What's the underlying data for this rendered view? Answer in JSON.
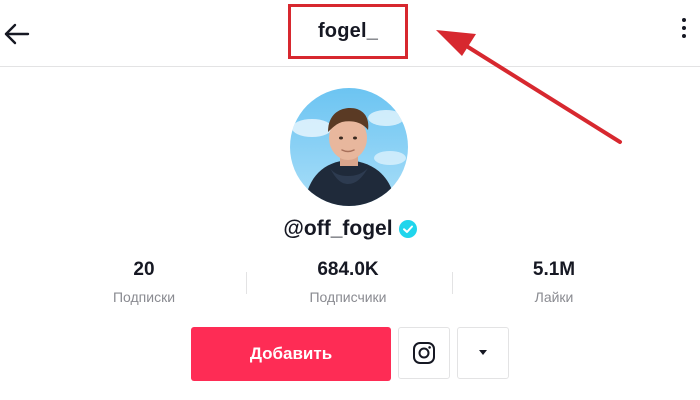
{
  "header": {
    "title": "fogel_",
    "back_icon": "arrow-left-icon",
    "more_icon": "more-vertical-icon"
  },
  "profile": {
    "username": "@off_fogel",
    "verified_icon": "verified-check-icon",
    "verified_color": "#20d5ec"
  },
  "stats": [
    {
      "value": "20",
      "label": "Подписки"
    },
    {
      "value": "684.0K",
      "label": "Подписчики"
    },
    {
      "value": "5.1M",
      "label": "Лайки"
    }
  ],
  "actions": {
    "follow_label": "Добавить",
    "follow_color": "#fe2c55",
    "instagram_icon": "instagram-icon",
    "dropdown_icon": "caret-down-icon"
  },
  "annotation": {
    "highlight_color": "#d7282f"
  }
}
